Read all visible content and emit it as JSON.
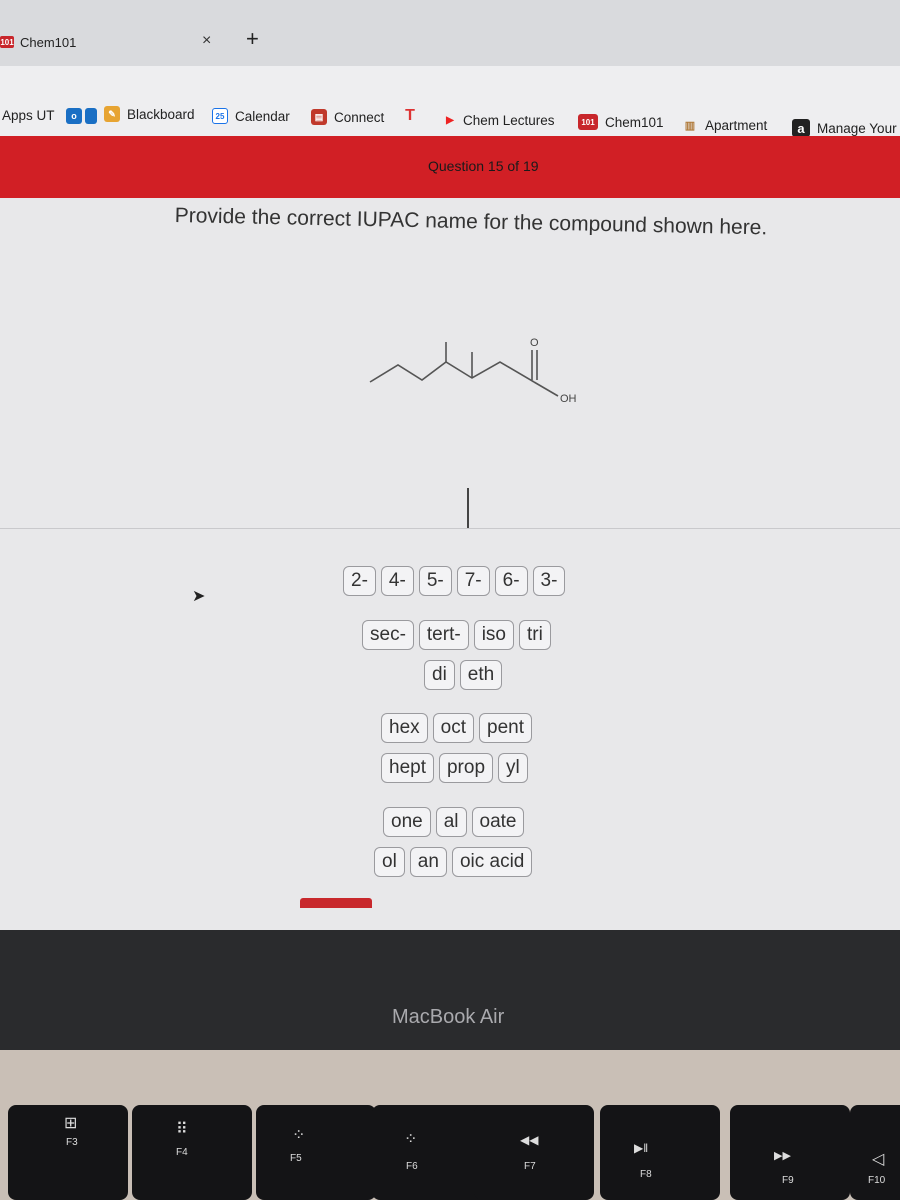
{
  "browser": {
    "active_tab": {
      "label": "Chem101",
      "favicon": "101",
      "close_icon": "×"
    },
    "new_tab_icon": "+",
    "bookmarks": [
      {
        "label": "Apps UT",
        "icon": "apps-icon"
      },
      {
        "label": "",
        "icon": "outlook-icon",
        "icon_text": "o"
      },
      {
        "label": "Blackboard",
        "icon": "blackboard-icon"
      },
      {
        "label": "Calendar",
        "icon": "calendar-icon",
        "icon_text": "25"
      },
      {
        "label": "Connect",
        "icon": "connect-icon"
      },
      {
        "label": "",
        "icon": "t-icon",
        "icon_text": "T"
      },
      {
        "label": "Chem Lectures",
        "icon": "youtube-icon"
      },
      {
        "label": "Chem101",
        "icon": "chem101-icon",
        "icon_text": "101"
      },
      {
        "label": "Apartment",
        "icon": "apartment-icon"
      },
      {
        "label": "Manage Your",
        "icon": "amazon-icon",
        "icon_text": "a"
      }
    ]
  },
  "question": {
    "counter": "Question 15 of 19",
    "prompt": "Provide the correct IUPAC name for the compound shown here.",
    "molecule_labels": {
      "carbonyl_o": "O",
      "hydroxyl": "OH"
    },
    "brand_color": "#d11f25"
  },
  "tiles": {
    "locants": [
      "2-",
      "4-",
      "5-",
      "7-",
      "6-",
      "3-"
    ],
    "prefixes": [
      "sec-",
      "tert-",
      "iso",
      "tri"
    ],
    "multipliers": [
      "di",
      "eth"
    ],
    "roots_row1": [
      "hex",
      "oct",
      "pent"
    ],
    "roots_row2": [
      "hept",
      "prop",
      "yl"
    ],
    "suffix_row1": [
      "one",
      "al",
      "oate"
    ],
    "suffix_row2": [
      "ol",
      "an",
      "oic acid"
    ]
  },
  "laptop": {
    "brand": "MacBook Air",
    "keys": [
      {
        "glyph": "⊞",
        "label": "F3"
      },
      {
        "glyph": "⠿",
        "label": "F4"
      },
      {
        "glyph": "⁘",
        "label": "F5"
      },
      {
        "glyph": "⁘",
        "label": "F6"
      },
      {
        "glyph": "◀◀",
        "label": "F7"
      },
      {
        "glyph": "▶‖",
        "label": "F8"
      },
      {
        "glyph": "▶▶",
        "label": "F9"
      },
      {
        "glyph": "◁",
        "label": "F10"
      }
    ]
  }
}
